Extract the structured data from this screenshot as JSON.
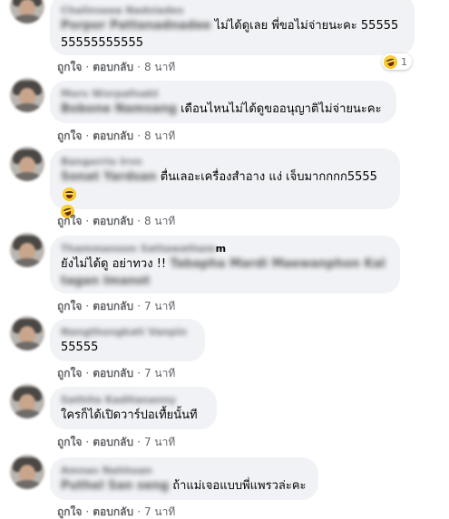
{
  "comments": [
    {
      "author": "Chalinseea Nadsiades",
      "text_blurred": "Porpor Pattanadnadee",
      "text": "ไม่ได้ดูเลย พี่ขอไม่จ่ายนะคะ 5555555555555555",
      "like_label": "ถูกใจ",
      "reply_label": "ตอบกลับ",
      "time": "8 นาที",
      "reaction": {
        "icon": "laughing-emoji-icon",
        "count": "1"
      }
    },
    {
      "author": "Mors Wnrpafnakt",
      "text_blurred": "Bobone Namsang",
      "text": "เดือนไหนไม่ได้ดูขออนุญาติไม่จ่ายนะคะ",
      "like_label": "ถูกใจ",
      "reply_label": "ตอบกลับ",
      "time": "8 นาที"
    },
    {
      "author": "Bangorrio Irvn",
      "text_blurred": "Sonat Yardsan",
      "text": "ตื่นเลอะเครื่องสำอาง แง่ เจ็บมากกกก5555",
      "emoji_icon": "laughing-emoji-icon",
      "like_label": "ถูกใจ",
      "reply_label": "ตอบกลับ",
      "time": "8 นาที"
    },
    {
      "author": "Thammanoon Sattawatham",
      "author_tail": "m",
      "text": "ยังไม่ได้ดู อย่าทวง !!",
      "text_blurred": "Tabapha Mardi Maewanphon Kaltagan Imanot",
      "like_label": "ถูกใจ",
      "reply_label": "ตอบกลับ",
      "time": "7 นาที"
    },
    {
      "author": "Nangthongkati Vanpin",
      "text": "55555",
      "like_label": "ถูกใจ",
      "reply_label": "ตอบกลับ",
      "time": "7 นาที"
    },
    {
      "author": "Sathita Kaditananny",
      "text": "ใครก็ได้เปิดวาร์ปอเทื้ยนั้นที",
      "like_label": "ถูกใจ",
      "reply_label": "ตอบกลับ",
      "time": "7 นาที"
    },
    {
      "author": "Amnas Nahhoan",
      "text_blurred": "Puthel San seng",
      "text": "ถ้าแม่เจอแบบพี่แพรวล่ะคะ",
      "like_label": "ถูกใจ",
      "reply_label": "ตอบกลับ",
      "time": "7 นาที"
    }
  ]
}
